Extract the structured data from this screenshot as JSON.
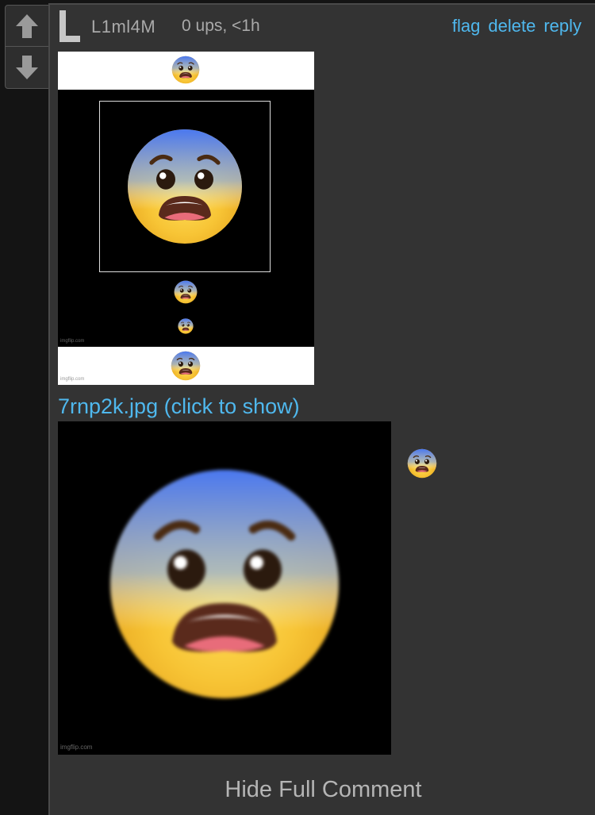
{
  "vote": {
    "up_icon": "arrow-up-icon",
    "down_icon": "arrow-down-icon"
  },
  "comment": {
    "avatar_letter": "L",
    "username": "L1ml4M",
    "meta": "0 ups, <1h",
    "actions": {
      "flag": "flag",
      "delete": "delete",
      "reply": "reply"
    },
    "meme_watermark": "imgflip.com",
    "image_link": "7rnp2k.jpg (click to show)",
    "hide_label": "Hide Full Comment"
  },
  "colors": {
    "page_bg": "#141414",
    "comment_bg": "#333333",
    "link": "#4fb8ee",
    "muted_text": "#a9a9a9"
  }
}
